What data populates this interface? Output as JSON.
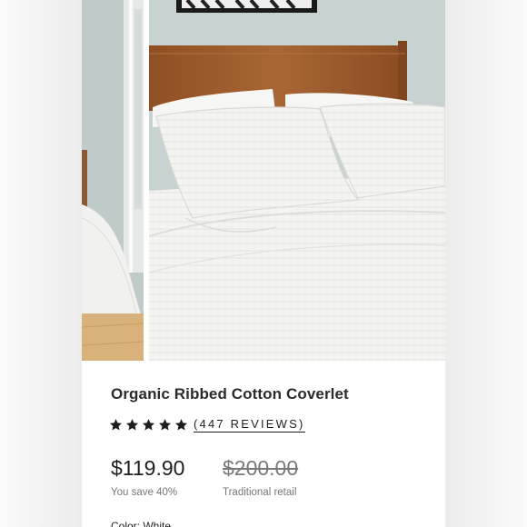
{
  "product": {
    "title": "Organic Ribbed Cotton Coverlet",
    "rating": 5,
    "reviews_label": "(447 REVIEWS)",
    "price": "$119.90",
    "savings": "You save 40%",
    "retail_price": "$200.00",
    "retail_label": "Traditional retail",
    "color_label": "Color: White"
  },
  "colors": {
    "wall": "#c9d3d2",
    "headboard": "#9a5a2c",
    "bedding": "#f3f3f1",
    "star": "#1f1f1f"
  }
}
